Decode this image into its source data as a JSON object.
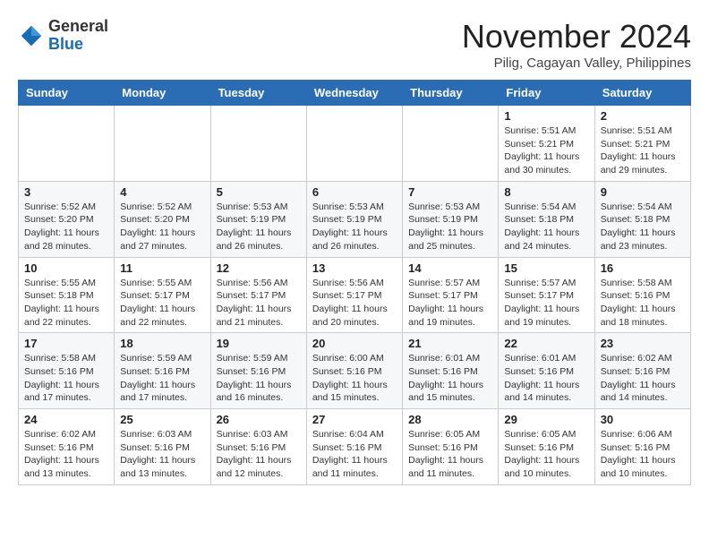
{
  "header": {
    "logo_general": "General",
    "logo_blue": "Blue",
    "month_title": "November 2024",
    "location": "Pilig, Cagayan Valley, Philippines"
  },
  "weekdays": [
    "Sunday",
    "Monday",
    "Tuesday",
    "Wednesday",
    "Thursday",
    "Friday",
    "Saturday"
  ],
  "weeks": [
    [
      {
        "day": "",
        "info": ""
      },
      {
        "day": "",
        "info": ""
      },
      {
        "day": "",
        "info": ""
      },
      {
        "day": "",
        "info": ""
      },
      {
        "day": "",
        "info": ""
      },
      {
        "day": "1",
        "info": "Sunrise: 5:51 AM\nSunset: 5:21 PM\nDaylight: 11 hours and 30 minutes."
      },
      {
        "day": "2",
        "info": "Sunrise: 5:51 AM\nSunset: 5:21 PM\nDaylight: 11 hours and 29 minutes."
      }
    ],
    [
      {
        "day": "3",
        "info": "Sunrise: 5:52 AM\nSunset: 5:20 PM\nDaylight: 11 hours and 28 minutes."
      },
      {
        "day": "4",
        "info": "Sunrise: 5:52 AM\nSunset: 5:20 PM\nDaylight: 11 hours and 27 minutes."
      },
      {
        "day": "5",
        "info": "Sunrise: 5:53 AM\nSunset: 5:19 PM\nDaylight: 11 hours and 26 minutes."
      },
      {
        "day": "6",
        "info": "Sunrise: 5:53 AM\nSunset: 5:19 PM\nDaylight: 11 hours and 26 minutes."
      },
      {
        "day": "7",
        "info": "Sunrise: 5:53 AM\nSunset: 5:19 PM\nDaylight: 11 hours and 25 minutes."
      },
      {
        "day": "8",
        "info": "Sunrise: 5:54 AM\nSunset: 5:18 PM\nDaylight: 11 hours and 24 minutes."
      },
      {
        "day": "9",
        "info": "Sunrise: 5:54 AM\nSunset: 5:18 PM\nDaylight: 11 hours and 23 minutes."
      }
    ],
    [
      {
        "day": "10",
        "info": "Sunrise: 5:55 AM\nSunset: 5:18 PM\nDaylight: 11 hours and 22 minutes."
      },
      {
        "day": "11",
        "info": "Sunrise: 5:55 AM\nSunset: 5:17 PM\nDaylight: 11 hours and 22 minutes."
      },
      {
        "day": "12",
        "info": "Sunrise: 5:56 AM\nSunset: 5:17 PM\nDaylight: 11 hours and 21 minutes."
      },
      {
        "day": "13",
        "info": "Sunrise: 5:56 AM\nSunset: 5:17 PM\nDaylight: 11 hours and 20 minutes."
      },
      {
        "day": "14",
        "info": "Sunrise: 5:57 AM\nSunset: 5:17 PM\nDaylight: 11 hours and 19 minutes."
      },
      {
        "day": "15",
        "info": "Sunrise: 5:57 AM\nSunset: 5:17 PM\nDaylight: 11 hours and 19 minutes."
      },
      {
        "day": "16",
        "info": "Sunrise: 5:58 AM\nSunset: 5:16 PM\nDaylight: 11 hours and 18 minutes."
      }
    ],
    [
      {
        "day": "17",
        "info": "Sunrise: 5:58 AM\nSunset: 5:16 PM\nDaylight: 11 hours and 17 minutes."
      },
      {
        "day": "18",
        "info": "Sunrise: 5:59 AM\nSunset: 5:16 PM\nDaylight: 11 hours and 17 minutes."
      },
      {
        "day": "19",
        "info": "Sunrise: 5:59 AM\nSunset: 5:16 PM\nDaylight: 11 hours and 16 minutes."
      },
      {
        "day": "20",
        "info": "Sunrise: 6:00 AM\nSunset: 5:16 PM\nDaylight: 11 hours and 15 minutes."
      },
      {
        "day": "21",
        "info": "Sunrise: 6:01 AM\nSunset: 5:16 PM\nDaylight: 11 hours and 15 minutes."
      },
      {
        "day": "22",
        "info": "Sunrise: 6:01 AM\nSunset: 5:16 PM\nDaylight: 11 hours and 14 minutes."
      },
      {
        "day": "23",
        "info": "Sunrise: 6:02 AM\nSunset: 5:16 PM\nDaylight: 11 hours and 14 minutes."
      }
    ],
    [
      {
        "day": "24",
        "info": "Sunrise: 6:02 AM\nSunset: 5:16 PM\nDaylight: 11 hours and 13 minutes."
      },
      {
        "day": "25",
        "info": "Sunrise: 6:03 AM\nSunset: 5:16 PM\nDaylight: 11 hours and 13 minutes."
      },
      {
        "day": "26",
        "info": "Sunrise: 6:03 AM\nSunset: 5:16 PM\nDaylight: 11 hours and 12 minutes."
      },
      {
        "day": "27",
        "info": "Sunrise: 6:04 AM\nSunset: 5:16 PM\nDaylight: 11 hours and 11 minutes."
      },
      {
        "day": "28",
        "info": "Sunrise: 6:05 AM\nSunset: 5:16 PM\nDaylight: 11 hours and 11 minutes."
      },
      {
        "day": "29",
        "info": "Sunrise: 6:05 AM\nSunset: 5:16 PM\nDaylight: 11 hours and 10 minutes."
      },
      {
        "day": "30",
        "info": "Sunrise: 6:06 AM\nSunset: 5:16 PM\nDaylight: 11 hours and 10 minutes."
      }
    ]
  ]
}
